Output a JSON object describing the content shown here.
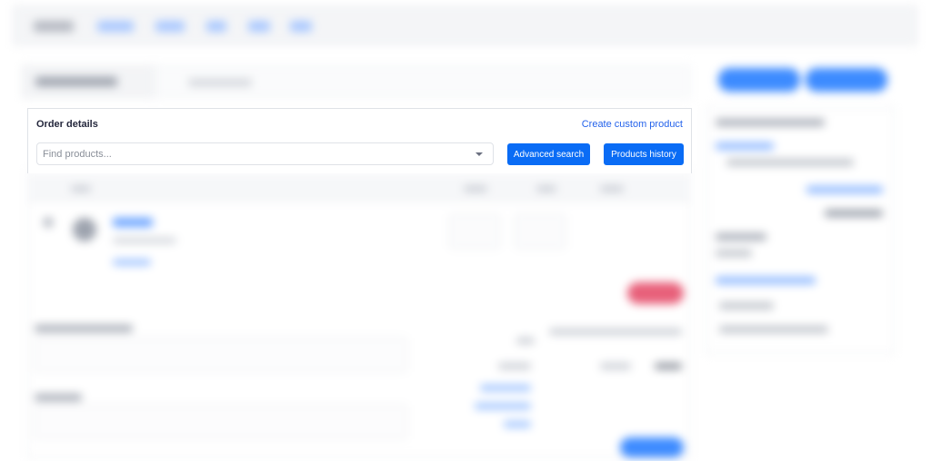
{
  "order_details": {
    "title": "Order details",
    "create_custom_product_link": "Create custom product",
    "search": {
      "placeholder": "Find products...",
      "value": ""
    },
    "advanced_search_button": "Advanced search",
    "products_history_button": "Products history"
  },
  "colors": {
    "primary": "#0a6cf5",
    "link": "#2563eb",
    "danger_blurred": "#e8607a",
    "text": "#25283d"
  },
  "icons": {
    "search_dropdown": "chevron-down-icon"
  }
}
